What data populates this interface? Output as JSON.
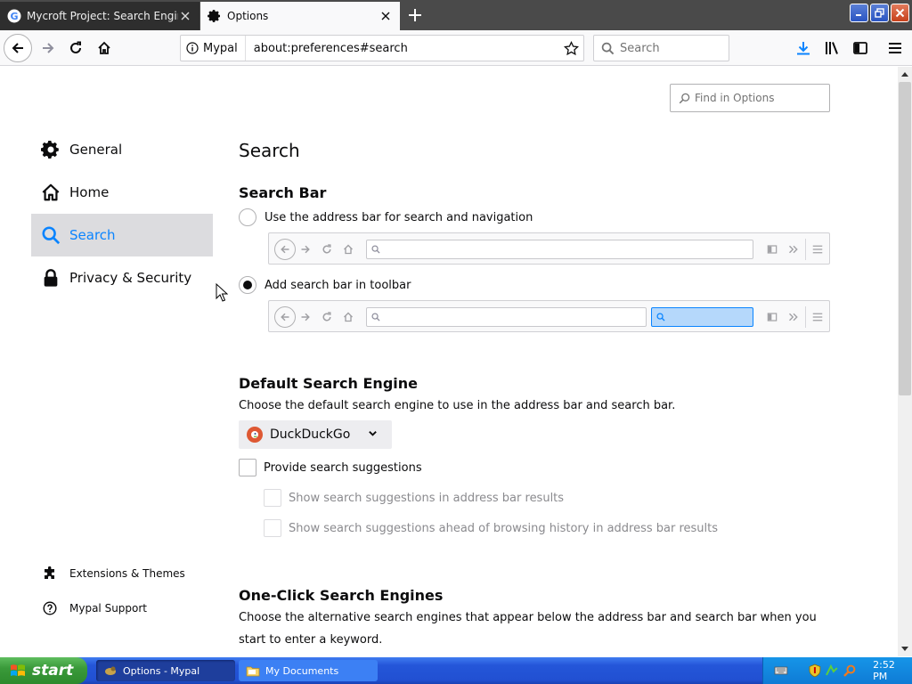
{
  "tabs": [
    {
      "title": "Mycroft Project: Search Engine Plu",
      "active": false
    },
    {
      "title": "Options",
      "active": true
    }
  ],
  "nav": {
    "identity_label": "Mypal",
    "url": "about:preferences#search",
    "search_placeholder": "Search"
  },
  "find": {
    "placeholder": "Find in Options"
  },
  "sidebar": {
    "categories": [
      {
        "label": "General",
        "icon": "gear-icon"
      },
      {
        "label": "Home",
        "icon": "home-icon"
      },
      {
        "label": "Search",
        "icon": "search-icon",
        "selected": true
      },
      {
        "label": "Privacy & Security",
        "icon": "lock-icon"
      }
    ],
    "footer": [
      {
        "label": "Extensions & Themes",
        "icon": "puzzle-icon"
      },
      {
        "label": "Mypal Support",
        "icon": "help-icon"
      }
    ]
  },
  "main": {
    "page_title": "Search",
    "search_bar": {
      "heading": "Search Bar",
      "option_address": "Use the address bar for search and navigation",
      "option_toolbar": "Add search bar in toolbar",
      "selected": "toolbar"
    },
    "default_engine": {
      "heading": "Default Search Engine",
      "description": "Choose the default search engine to use in the address bar and search bar.",
      "selected_engine": "DuckDuckGo",
      "provide_suggestions": "Provide search suggestions",
      "suggestions_in_address_bar": "Show search suggestions in address bar results",
      "suggestions_ahead": "Show search suggestions ahead of browsing history in address bar results"
    },
    "one_click": {
      "heading": "One-Click Search Engines",
      "description": "Choose the alternative search engines that appear below the address bar and search bar when you start to enter a keyword."
    }
  },
  "taskbar": {
    "start_label": "start",
    "tasks": [
      {
        "label": "Options - Mypal",
        "active": true
      },
      {
        "label": "My Documents",
        "active": false
      }
    ],
    "clock": "2:52 PM"
  },
  "colors": {
    "accent": "#0a84ff",
    "selected_bg": "#dcdcdf",
    "taskbar": "#2456d9",
    "start": "#3a9a3a"
  }
}
